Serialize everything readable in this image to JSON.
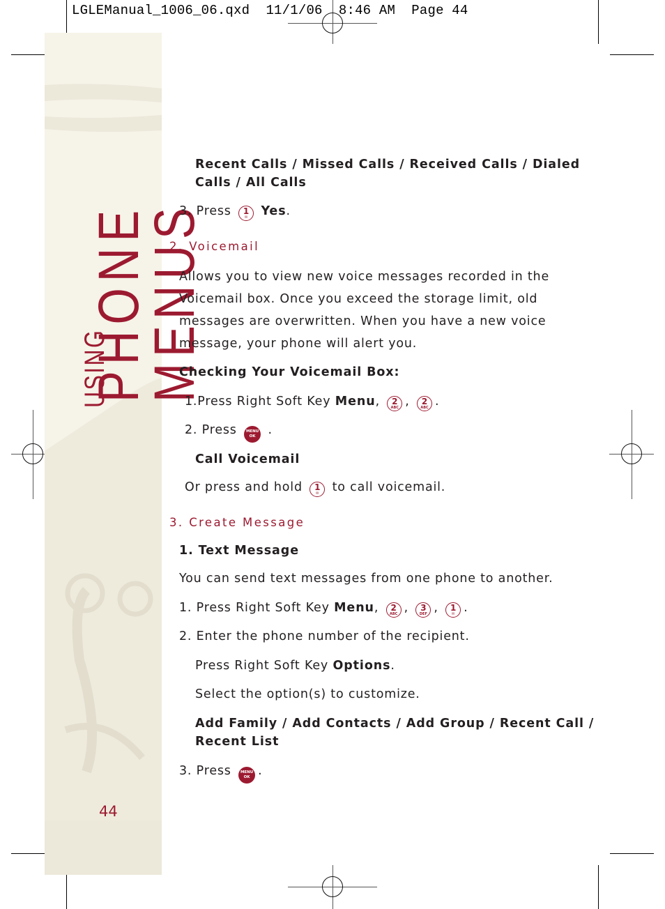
{
  "slug_line": "LGLEManual_1006_06.qxd  11/1/06  8:46 AM  Page 44",
  "sidebar": {
    "small_title": "USING",
    "big_title": "PHONE MENUS",
    "page_number": "44"
  },
  "colors": {
    "accent": "#9c1a30",
    "sidebar_bg": "#f6f3e8",
    "text": "#231f20"
  },
  "section1": {
    "options_line1": "Recent Calls / Missed Calls  / Received Calls / Dialed",
    "options_line2": "Calls / All Calls",
    "step3_prefix": "3. Press",
    "step3_key": {
      "num": "1",
      "sub": "✉",
      "icon": "key-1-icon"
    },
    "step3_bold": "Yes",
    "step3_end": "."
  },
  "voicemail": {
    "heading": "2. Voicemail",
    "para": [
      "Allows you to view new voice messages recorded in the",
      "Voicemail box. Once you exceed the storage limit, old",
      "messages are overwritten. When you have a new voice",
      "message, your phone will alert you."
    ],
    "subheading": "Checking Your Voicemail Box:",
    "step1_prefix": "1.Press Right Soft Key ",
    "step1_bold": "Menu",
    "step1_keys": [
      {
        "num": "2",
        "sub": "ABC"
      },
      {
        "num": "2",
        "sub": "ABC"
      }
    ],
    "step2_prefix": "2. Press",
    "ok_key": {
      "top": "MENU",
      "bottom": "OK"
    },
    "option": "Call Voicemail",
    "hold_prefix": "Or press and hold",
    "hold_key": {
      "num": "1",
      "sub": "✉"
    },
    "hold_suffix": "to call voicemail."
  },
  "create_message": {
    "heading": "3. Create Message",
    "subheading": "1. Text Message",
    "intro": "You can send text messages from one phone to another.",
    "step1_prefix": "1. Press Right Soft Key ",
    "step1_bold": "Menu",
    "step1_keys": [
      {
        "num": "2",
        "sub": "ABC"
      },
      {
        "num": "3",
        "sub": "DEF"
      },
      {
        "num": "1",
        "sub": "✉"
      }
    ],
    "step2": "2. Enter the phone number of the recipient.",
    "options_prefix": "Press Right Soft Key ",
    "options_bold": "Options",
    "select_line": "Select the option(s) to customize.",
    "choices_line1": "Add Family / Add Contacts / Add Group / Recent Call /",
    "choices_line2": "Recent List",
    "step3_prefix": "3. Press",
    "ok_key": {
      "top": "MENU",
      "bottom": "OK"
    }
  }
}
